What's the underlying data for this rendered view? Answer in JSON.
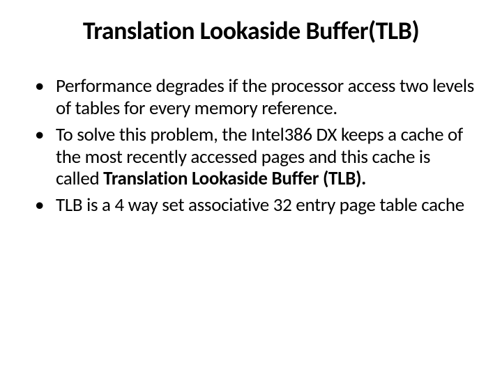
{
  "slide": {
    "title": "Translation Lookaside Buffer(TLB)",
    "bullets": [
      {
        "text": "Performance degrades if the processor access two levels of tables for every memory reference."
      },
      {
        "prefix": "To solve this problem, the Intel386 DX keeps a cache of the most recently accessed pages and this cache is called ",
        "bold": "Translation Lookaside Buffer (TLB)."
      },
      {
        "text": "TLB is a 4 way set associative 32 entry page table cache"
      }
    ]
  }
}
